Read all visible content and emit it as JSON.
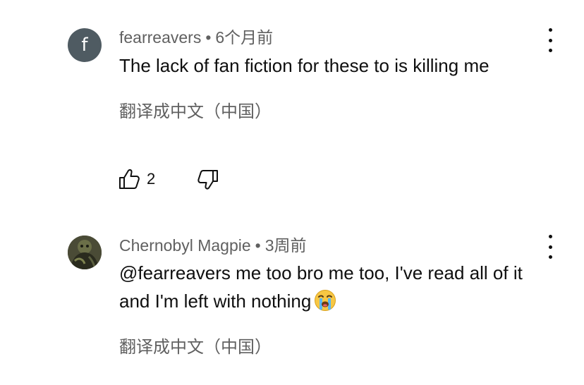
{
  "comments": [
    {
      "author": "fearreavers",
      "separator": "•",
      "time": "6个月前",
      "avatar_letter": "f",
      "text": "The lack of fan fiction for these to is killing me",
      "translate_label": "翻译成中文（中国）",
      "like_count": "2",
      "icons": {
        "like": "thumbs-up-icon",
        "dislike": "thumbs-down-icon",
        "more": "more-vertical-icon"
      }
    },
    {
      "author": "Chernobyl Magpie",
      "separator": "•",
      "time": "3周前",
      "text": "@fearreavers me too bro me too, I've read all of it and I'm left with nothing",
      "emoji": "crying-face",
      "translate_label": "翻译成中文（中国）",
      "icons": {
        "more": "more-vertical-icon"
      }
    }
  ],
  "colors": {
    "background": "#ffffff",
    "text_primary": "#0f0f0f",
    "text_secondary": "#606060",
    "avatar_bg": "#4f5b62"
  }
}
